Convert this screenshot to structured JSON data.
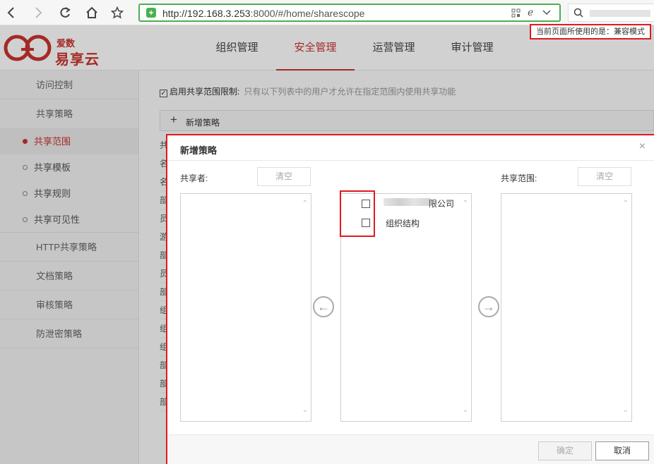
{
  "browser": {
    "url_host": "http://192.168.3.253",
    "url_path": ":8000/#/home/sharescope",
    "compat_badge": "当前页面所使用的是：兼容模式"
  },
  "app": {
    "logo_sub": "爱数",
    "logo_main": "易享云",
    "nav": [
      "组织管理",
      "安全管理",
      "运营管理",
      "审计管理"
    ],
    "active_nav": "安全管理"
  },
  "sidebar": {
    "items": [
      {
        "label": "访问控制"
      },
      {
        "label": "共享策略"
      }
    ],
    "sub_items": [
      {
        "label": "共享范围",
        "active": true
      },
      {
        "label": "共享模板"
      },
      {
        "label": "共享规则"
      },
      {
        "label": "共享可见性"
      }
    ],
    "more_items": [
      {
        "label": "HTTP共享策略"
      },
      {
        "label": "文档策略"
      },
      {
        "label": "审核策略"
      },
      {
        "label": "防泄密策略"
      }
    ]
  },
  "main": {
    "scope_checkbox_label": "启用共享范围限制:",
    "scope_hint": "只有以下列表中的用户才允许在指定范围内使用共享功能",
    "add_policy_label": "新增策略",
    "bg_row_chars": [
      "共",
      "名",
      "名",
      "部",
      "员",
      "游",
      "部",
      "员",
      "部",
      "组",
      "组",
      "组",
      "部",
      "部",
      "部"
    ]
  },
  "modal": {
    "title": "新增策略",
    "sharer_label": "共享者:",
    "scope_label": "共享范围:",
    "clear_label": "清空",
    "tree": [
      {
        "label": "限公司"
      },
      {
        "label": "组织结构"
      }
    ],
    "confirm_label": "确定",
    "cancel_label": "取消"
  },
  "colors": {
    "accent": "#c9342f",
    "highlight_border": "#e0191f",
    "url_border": "#4caf50"
  }
}
